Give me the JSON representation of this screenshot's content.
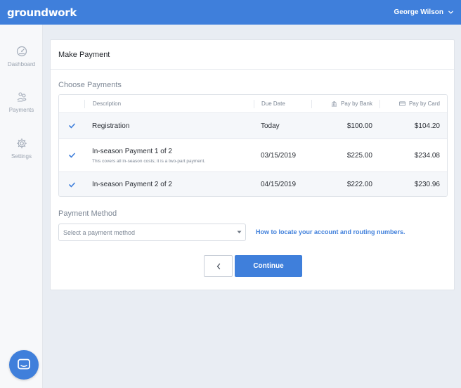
{
  "app": {
    "logo": "groundwork",
    "user_name": "George Wilson",
    "accent_color": "#3f7fdb"
  },
  "sidebar": {
    "items": [
      {
        "label": "Dashboard",
        "icon": "speedometer-icon"
      },
      {
        "label": "Payments",
        "icon": "payments-icon"
      },
      {
        "label": "Settings",
        "icon": "gear-icon"
      }
    ],
    "chat_icon": "chat-bubble-icon"
  },
  "card": {
    "title": "Make Payment",
    "choose_title": "Choose Payments",
    "method_title": "Payment Method"
  },
  "table": {
    "headers": {
      "description": "Description",
      "due_date": "Due Date",
      "pay_by_bank": "Pay by Bank",
      "pay_by_card": "Pay by Card"
    },
    "rows": [
      {
        "checked": true,
        "description": "Registration",
        "note": "",
        "due_date": "Today",
        "bank": "$100.00",
        "card": "$104.20"
      },
      {
        "checked": true,
        "description": "In-season Payment 1 of 2",
        "note": "This covers all in-season costs; it is a two-part payment.",
        "due_date": "03/15/2019",
        "bank": "$225.00",
        "card": "$234.08"
      },
      {
        "checked": true,
        "description": "In-season Payment 2 of 2",
        "note": "",
        "due_date": "04/15/2019",
        "bank": "$222.00",
        "card": "$230.96"
      }
    ]
  },
  "payment_method": {
    "placeholder": "Select a payment method",
    "help_link": "How to locate your account and routing numbers."
  },
  "actions": {
    "back_icon": "chevron-left-icon",
    "continue_label": "Continue"
  }
}
